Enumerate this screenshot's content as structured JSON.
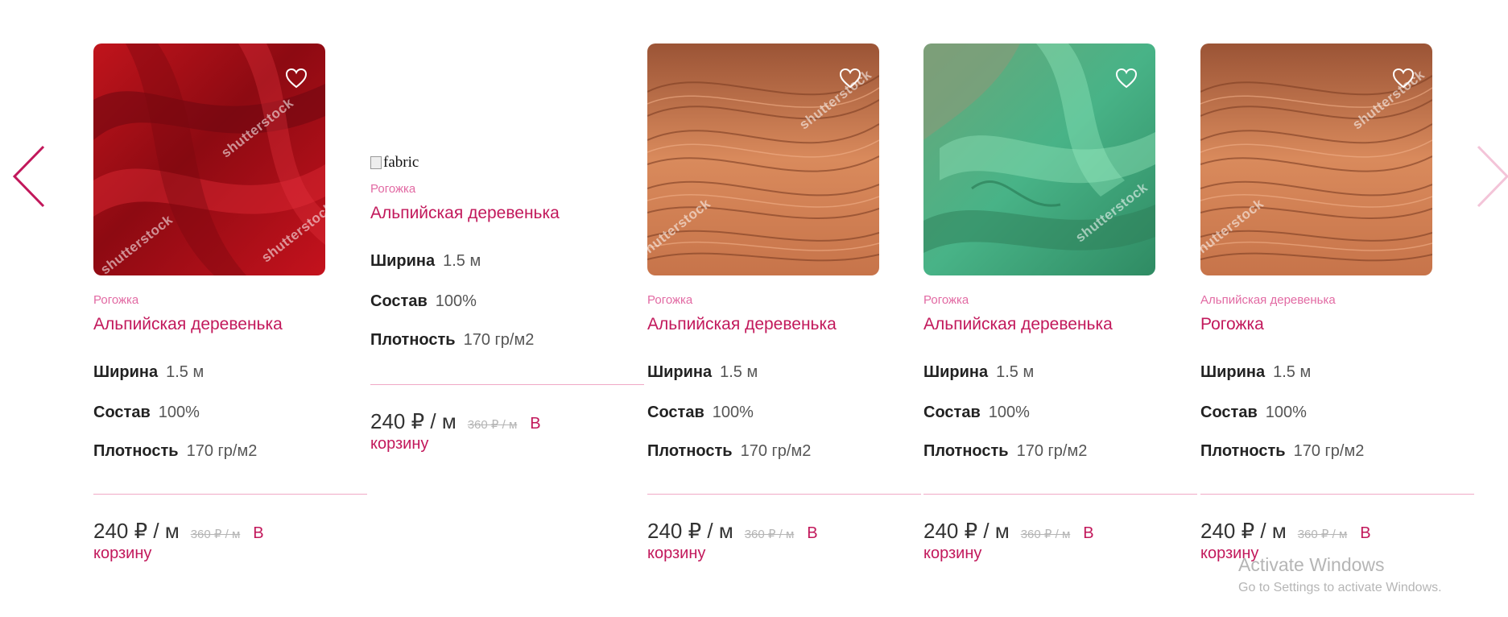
{
  "navigation": {
    "prev_icon": "chevron-left-icon",
    "next_icon": "chevron-right-icon"
  },
  "products": [
    {
      "category": "Рогожка",
      "title": "Альпийская деревенька",
      "width_label": "Ширина",
      "width_value": "1.5 м",
      "composition_label": "Состав",
      "composition_value": "100%",
      "density_label": "Плотность",
      "density_value": "170 гр/м2",
      "price": "240 ₽ / м",
      "old_price": "360 ₽ / м",
      "cart_line1": "В",
      "cart_line2": "корзину"
    },
    {
      "image_alt": "fabric",
      "category": "Рогожка",
      "title": "Альпийская деревенька",
      "width_label": "Ширина",
      "width_value": "1.5 м",
      "composition_label": "Состав",
      "composition_value": "100%",
      "density_label": "Плотность",
      "density_value": "170 гр/м2",
      "price": "240 ₽ / м",
      "old_price": "360 ₽ / м",
      "cart_line1": "В",
      "cart_line2": "корзину"
    },
    {
      "category": "Рогожка",
      "title": "Альпийская деревенька",
      "width_label": "Ширина",
      "width_value": "1.5 м",
      "composition_label": "Состав",
      "composition_value": "100%",
      "density_label": "Плотность",
      "density_value": "170 гр/м2",
      "price": "240 ₽ / м",
      "old_price": "360 ₽ / м",
      "cart_line1": "В",
      "cart_line2": "корзину"
    },
    {
      "category": "Рогожка",
      "title": "Альпийская деревенька",
      "width_label": "Ширина",
      "width_value": "1.5 м",
      "composition_label": "Состав",
      "composition_value": "100%",
      "density_label": "Плотность",
      "density_value": "170 гр/м2",
      "price": "240 ₽ / м",
      "old_price": "360 ₽ / м",
      "cart_line1": "В",
      "cart_line2": "корзину"
    },
    {
      "category": "Альпийская деревенька",
      "title": "Рогожка",
      "width_label": "Ширина",
      "width_value": "1.5 м",
      "composition_label": "Состав",
      "composition_value": "100%",
      "density_label": "Плотность",
      "density_value": "170 гр/м2",
      "price": "240 ₽ / м",
      "old_price": "360 ₽ / м",
      "cart_line1": "В",
      "cart_line2": "корзину"
    }
  ],
  "watermark": {
    "brand": "shutterstock"
  },
  "os_overlay": {
    "line1": "Activate Windows",
    "line2": "Go to Settings to activate Windows."
  },
  "colors": {
    "accent": "#c2185b",
    "accent_light": "#e26aa3",
    "divider": "#f0a9c6"
  }
}
